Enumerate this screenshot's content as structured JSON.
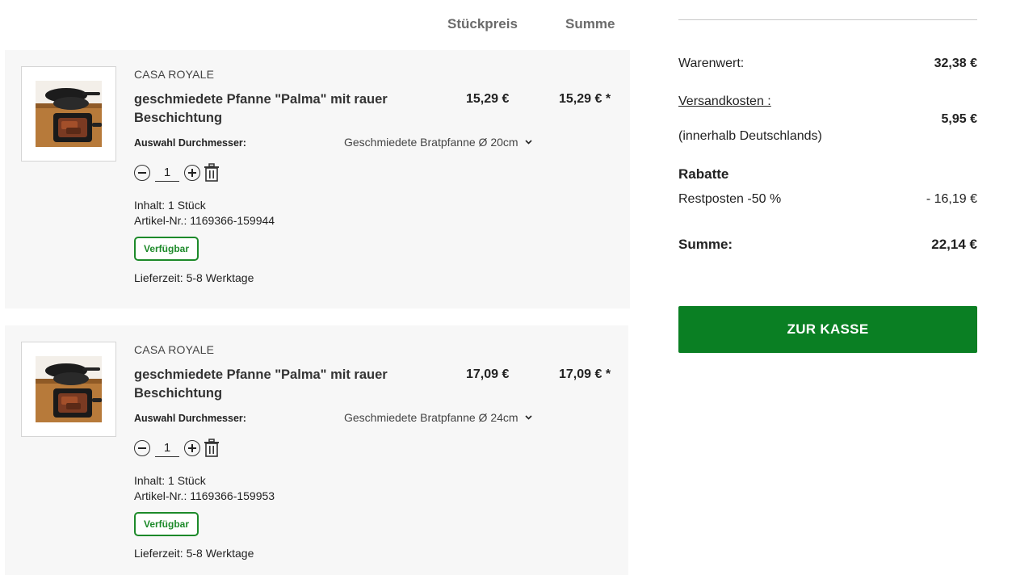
{
  "columns": {
    "unit_price": "Stückpreis",
    "sum": "Summe"
  },
  "items": [
    {
      "brand": "CASA ROYALE",
      "title": "geschmiedete Pfanne \"Palma\" mit rauer Beschichtung",
      "unit_price": "15,29 €",
      "line_sum": "15,29 € *",
      "option_label": "Auswahl Durchmesser:",
      "option_value": "Geschmiedete Bratpfanne Ø 20cm",
      "quantity": "1",
      "content": "Inhalt: 1 Stück",
      "article_no": "Artikel-Nr.: 1169366-159944",
      "availability": "Verfügbar",
      "delivery": "Lieferzeit: 5-8 Werktage"
    },
    {
      "brand": "CASA ROYALE",
      "title": "geschmiedete Pfanne \"Palma\" mit rauer Beschichtung",
      "unit_price": "17,09 €",
      "line_sum": "17,09 € *",
      "option_label": "Auswahl Durchmesser:",
      "option_value": "Geschmiedete Bratpfanne Ø 24cm",
      "quantity": "1",
      "content": "Inhalt: 1 Stück",
      "article_no": "Artikel-Nr.: 1169366-159953",
      "availability": "Verfügbar",
      "delivery": "Lieferzeit: 5-8 Werktage"
    }
  ],
  "summary": {
    "goods_label": "Warenwert:",
    "goods_value": "32,38 €",
    "shipping_label": "Versandkosten :",
    "shipping_note": "(innerhalb Deutschlands)",
    "shipping_value": "5,95 €",
    "discounts_heading": "Rabatte",
    "discount_label": "Restposten -50 %",
    "discount_value": "- 16,19 €",
    "total_label": "Summe:",
    "total_value": "22,14 €",
    "checkout_label": "ZUR KASSE"
  },
  "icons": {
    "minus": "minus-circle-icon",
    "plus": "plus-circle-icon",
    "trash": "trash-icon",
    "chevron": "chevron-down-icon"
  },
  "colors": {
    "accent_green": "#0a7f23",
    "availability_green": "#1d8a2a",
    "item_background": "#f7f7f7"
  }
}
